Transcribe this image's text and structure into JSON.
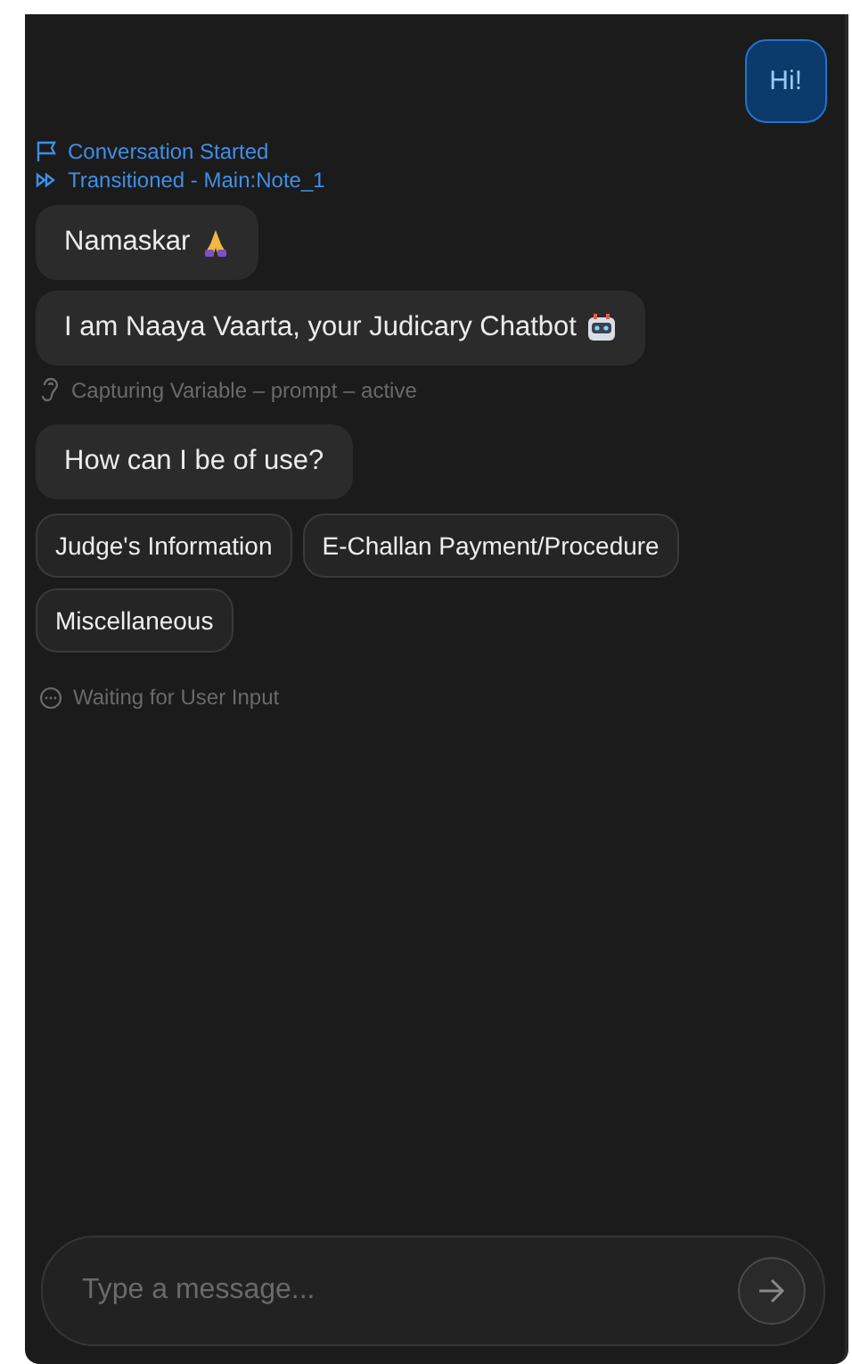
{
  "timeline": [
    {
      "kind": "user",
      "text": "Hi!"
    },
    {
      "kind": "start",
      "text": "Conversation Started"
    },
    {
      "kind": "transition",
      "text": "Transitioned - Main:Note_1"
    },
    {
      "kind": "greeting",
      "text": "Namaskar"
    },
    {
      "kind": "intro",
      "text": "I am Naaya Vaarta, your Judicary Chatbot"
    },
    {
      "kind": "capture",
      "text": "Capturing Variable – prompt – active"
    },
    {
      "kind": "bot",
      "text": "How can I be of use?"
    },
    {
      "kind": "choices",
      "options": [
        "Judge's Information",
        "E-Challan Payment/Procedure",
        "Miscellaneous"
      ]
    },
    {
      "kind": "waiting",
      "text": "Waiting for User Input"
    }
  ],
  "composer": {
    "placeholder": "Type a message..."
  }
}
